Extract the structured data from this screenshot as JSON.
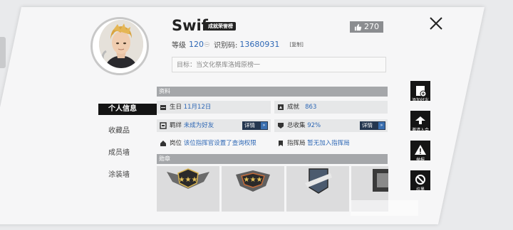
{
  "profile": {
    "username": "Swif",
    "title_badge": "成就荣誉榜",
    "likes": "270",
    "level_label": "等级",
    "level_value": "120",
    "id_label": "识别码:",
    "id_value": "13680931",
    "copy_label": "[复制]",
    "goal_text": "目标：当文化祭库洛姆原榜一"
  },
  "nav": {
    "items": [
      {
        "label": "个人信息",
        "active": true
      },
      {
        "label": "收藏品",
        "active": false
      },
      {
        "label": "成员墙",
        "active": false
      },
      {
        "label": "涂装墙",
        "active": false
      }
    ]
  },
  "info": {
    "section_title": "资料",
    "birthday_label": "生日",
    "birthday_value": "11月12日",
    "achievement_label": "成就",
    "achievement_value": "863",
    "bond_label": "羁绊",
    "bond_value": "未成为好友",
    "detail_label": "详情",
    "collection_label": "总收集",
    "collection_value": "92%",
    "post_label": "岗位",
    "post_value": "该位指挥官设置了查询权限",
    "command_label": "指挥局",
    "command_value": "暂无加入指挥局"
  },
  "medals": {
    "section_title": "勋章",
    "count": 4
  },
  "actions": {
    "add_friend": "添加好友",
    "invite": "邀请入会",
    "report": "举报",
    "block": "拉黑"
  },
  "colors": {
    "accent_blue": "#2d67b5",
    "detail_dark": "#24364f",
    "nav_active": "#141414",
    "section_gray": "#a5a7aa"
  },
  "icons": {
    "likes": "thumbs-up-icon",
    "close": "close-icon",
    "add_friend": "add-user-icon",
    "invite": "invite-icon",
    "report": "warning-icon",
    "block": "block-icon"
  }
}
